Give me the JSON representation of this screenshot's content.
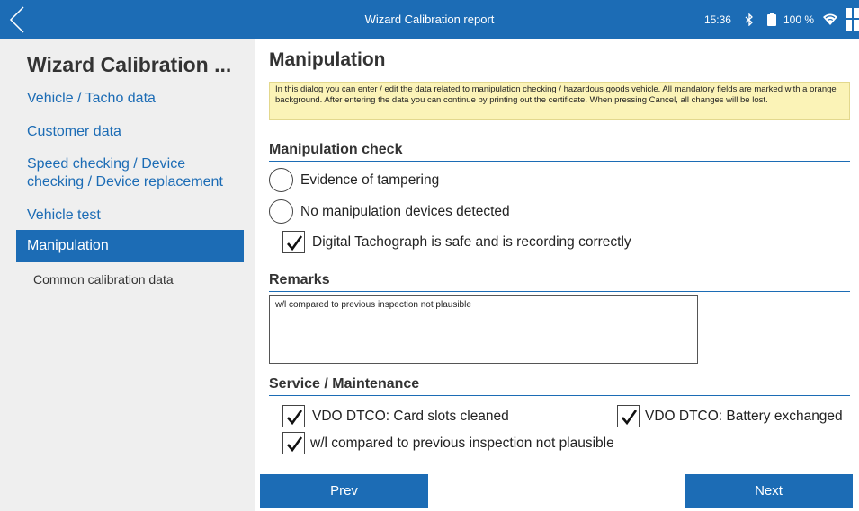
{
  "topbar": {
    "title": "Wizard Calibration report",
    "time": "15:36",
    "battery": "100 %"
  },
  "sidebar": {
    "title": "Wizard Calibration ...",
    "items": [
      {
        "label": "Vehicle / Tacho data"
      },
      {
        "label": "Customer data"
      },
      {
        "label": "Speed checking / Device checking / Device replacement"
      },
      {
        "label": "Vehicle test"
      },
      {
        "label": "Manipulation",
        "active": true
      }
    ],
    "sub_items": [
      {
        "label": "Common calibration data"
      }
    ]
  },
  "main": {
    "title": "Manipulation",
    "info": "In this dialog you can enter / edit the data related to manipulation checking / hazardous goods vehicle. All mandatory fields are marked with a orange background. After entering the data you can continue by printing out the certificate. When pressing Cancel, all changes will be lost.",
    "manipulation_check": {
      "heading": "Manipulation check",
      "options": [
        {
          "label": "Evidence of tampering",
          "checked": false
        },
        {
          "label": "No manipulation devices detected",
          "checked": false
        }
      ],
      "safe_check": {
        "label": "Digital Tachograph is safe and is recording correctly",
        "checked": true
      }
    },
    "remarks": {
      "heading": "Remarks",
      "value": "w/l compared to previous inspection not plausible"
    },
    "service": {
      "heading": "Service / Maintenance",
      "items": [
        {
          "label": "VDO DTCO: Card slots cleaned",
          "checked": true
        },
        {
          "label": "VDO DTCO: Battery exchanged",
          "checked": true
        },
        {
          "label": "w/l compared to previous inspection not plausible",
          "checked": true
        }
      ]
    },
    "buttons": {
      "prev": "Prev",
      "next": "Next"
    }
  },
  "colors": {
    "accent": "#1c6cb5",
    "sidebar_bg": "#efefef",
    "info_bg": "#fbf3b7"
  }
}
